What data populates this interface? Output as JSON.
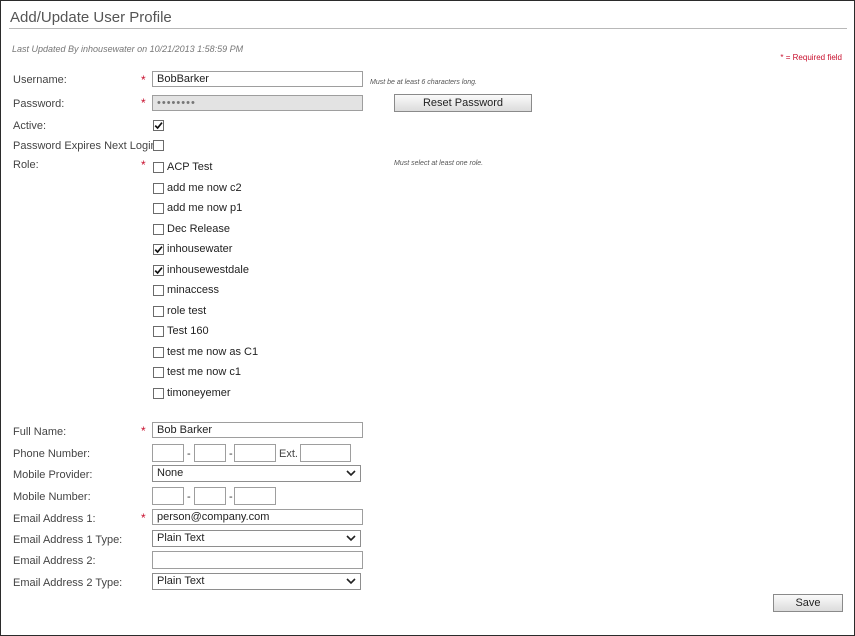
{
  "page": {
    "title": "Add/Update User Profile",
    "last_updated": "Last Updated By inhousewater on 10/21/2013 1:58:59 PM",
    "required_note": "* = Required field"
  },
  "required_marker": "*",
  "colors": {
    "required": "#c8102e",
    "border": "#9e9e9e",
    "disabled_bg": "#e3e3e3"
  },
  "form": {
    "username": {
      "label": "Username:",
      "value": "BobBarker",
      "hint": "Must be at least 6 characters long."
    },
    "password": {
      "label": "Password:",
      "value": "••••••••",
      "reset_button": "Reset Password"
    },
    "active": {
      "label": "Active:",
      "checked": true
    },
    "password_expires": {
      "label": "Password Expires Next Login:",
      "checked": false
    },
    "role": {
      "label": "Role:",
      "hint": "Must select at least one role.",
      "options": [
        {
          "name": "ACP Test",
          "checked": false
        },
        {
          "name": "add me now c2",
          "checked": false
        },
        {
          "name": "add me now p1",
          "checked": false
        },
        {
          "name": "Dec Release",
          "checked": false
        },
        {
          "name": "inhousewater",
          "checked": true
        },
        {
          "name": "inhousewestdale",
          "checked": true
        },
        {
          "name": "minaccess",
          "checked": false
        },
        {
          "name": "role test",
          "checked": false
        },
        {
          "name": "Test 160",
          "checked": false
        },
        {
          "name": "test me now as C1",
          "checked": false
        },
        {
          "name": "test me now c1",
          "checked": false
        },
        {
          "name": "timoneyemer",
          "checked": false
        }
      ]
    },
    "full_name": {
      "label": "Full Name:",
      "value": "Bob Barker"
    },
    "phone_number": {
      "label": "Phone Number:",
      "dash": "-",
      "ext_label": "Ext.",
      "area": "",
      "prefix": "",
      "line": "",
      "ext": ""
    },
    "mobile_provider": {
      "label": "Mobile Provider:",
      "selected": "None"
    },
    "mobile_number": {
      "label": "Mobile Number:",
      "dash": "-",
      "area": "",
      "prefix": "",
      "line": ""
    },
    "email_1": {
      "label": "Email Address 1:",
      "value": "person@company.com"
    },
    "email_1_type": {
      "label": "Email Address 1 Type:",
      "selected": "Plain Text"
    },
    "email_2": {
      "label": "Email Address 2:",
      "value": ""
    },
    "email_2_type": {
      "label": "Email Address 2 Type:",
      "selected": "Plain Text"
    }
  },
  "actions": {
    "save": "Save"
  }
}
